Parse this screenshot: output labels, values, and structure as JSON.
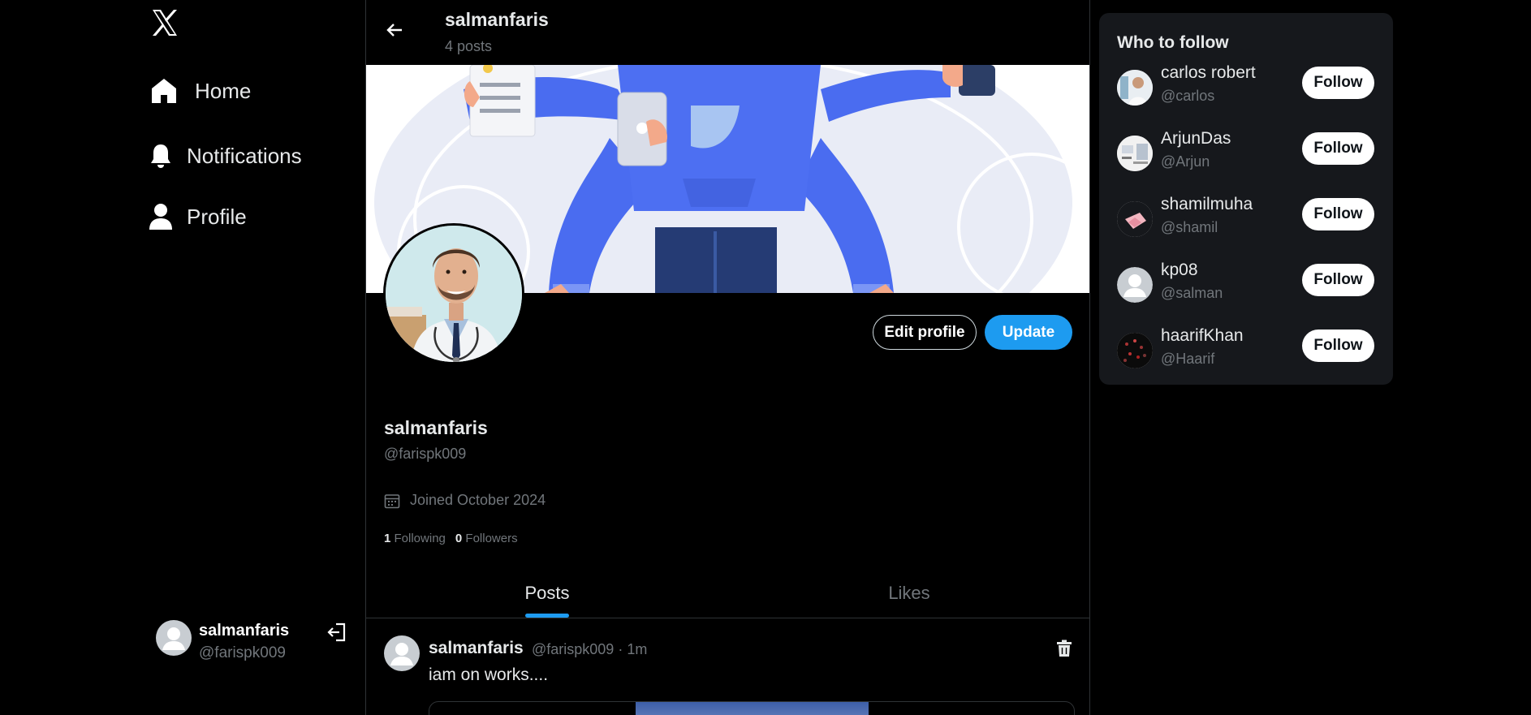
{
  "nav": {
    "logo_icon": "x-logo-icon",
    "items": [
      {
        "label": "Home",
        "icon": "home-icon"
      },
      {
        "label": "Notifications",
        "icon": "bell-icon"
      },
      {
        "label": "Profile",
        "icon": "person-icon"
      }
    ]
  },
  "account": {
    "name": "salmanfaris",
    "handle": "@farispk009",
    "logout_icon": "logout-icon"
  },
  "header": {
    "title": "salmanfaris",
    "subtitle": "4 posts"
  },
  "profile": {
    "edit_label": "Edit profile",
    "update_label": "Update",
    "name": "salmanfaris",
    "handle": "@farispk009",
    "joined": "Joined October 2024",
    "following_count": "1",
    "following_label": "Following",
    "followers_count": "0",
    "followers_label": "Followers"
  },
  "tabs": [
    {
      "label": "Posts",
      "active": true
    },
    {
      "label": "Likes",
      "active": false
    }
  ],
  "post": {
    "author": "salmanfaris",
    "meta": "@farispk009 · 1m",
    "text": "iam on works...."
  },
  "who_to_follow": {
    "title": "Who to follow",
    "button_label": "Follow",
    "users": [
      {
        "name": "carlos robert",
        "handle": "@carlos"
      },
      {
        "name": "ArjunDas",
        "handle": "@Arjun"
      },
      {
        "name": "shamilmuha",
        "handle": "@shamil"
      },
      {
        "name": "kp08",
        "handle": "@salman"
      },
      {
        "name": "haarifKhan",
        "handle": "@Haarif"
      }
    ]
  },
  "colors": {
    "accent": "#1d9bf0",
    "background": "#000000",
    "muted_text": "#71767b",
    "panel": "#16181c"
  }
}
